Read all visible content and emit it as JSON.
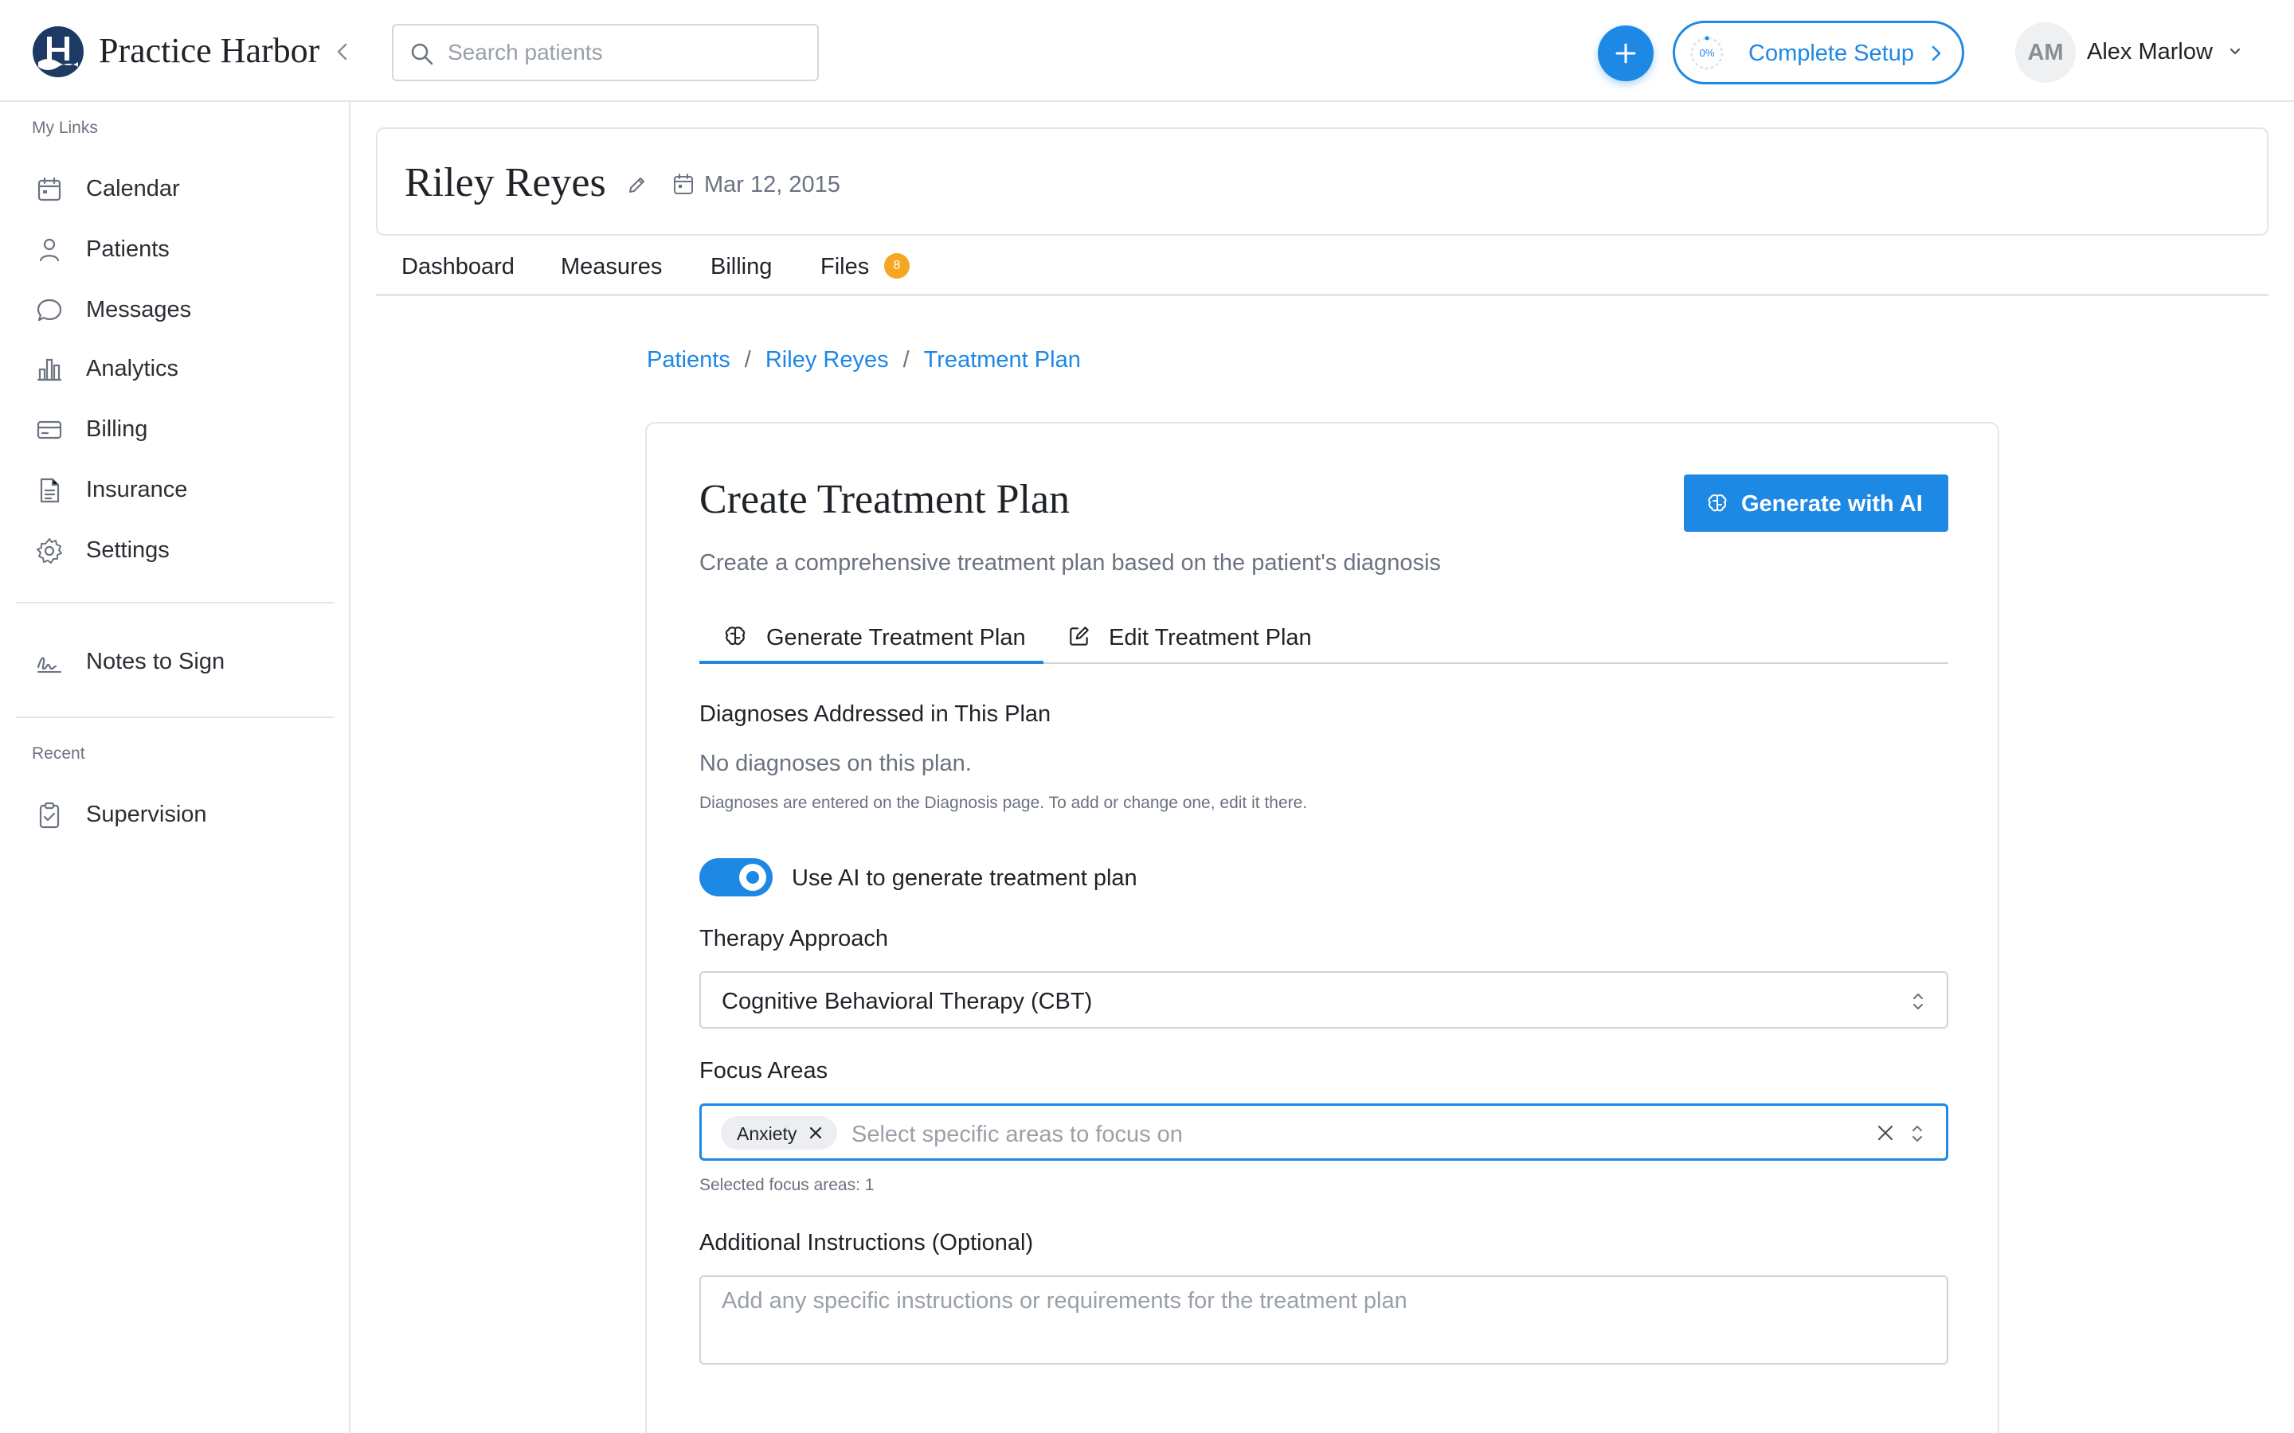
{
  "app": {
    "brand": "Practice Harbor"
  },
  "header": {
    "search_placeholder": "Search patients",
    "setup_progress": "0%",
    "setup_label": "Complete Setup",
    "user_initials": "AM",
    "user_name": "Alex Marlow",
    "accent_color": "#1e88e5"
  },
  "sidebar": {
    "my_links_label": "My Links",
    "items": [
      {
        "label": "Calendar",
        "icon": "calendar-icon"
      },
      {
        "label": "Patients",
        "icon": "person-icon"
      },
      {
        "label": "Messages",
        "icon": "chat-bubble-icon"
      },
      {
        "label": "Analytics",
        "icon": "bar-chart-icon"
      },
      {
        "label": "Billing",
        "icon": "credit-card-icon"
      },
      {
        "label": "Insurance",
        "icon": "document-icon"
      },
      {
        "label": "Settings",
        "icon": "gear-icon"
      }
    ],
    "notes_to_sign": "Notes to Sign",
    "recent_label": "Recent",
    "recent_items": [
      {
        "label": "Supervision",
        "icon": "clipboard-check-icon"
      }
    ]
  },
  "patient": {
    "name": "Riley Reyes",
    "dob": "Mar 12, 2015",
    "tabs": [
      {
        "label": "Dashboard"
      },
      {
        "label": "Measures"
      },
      {
        "label": "Billing"
      },
      {
        "label": "Files",
        "badge": "8"
      }
    ]
  },
  "breadcrumb": [
    {
      "label": "Patients"
    },
    {
      "label": "Riley Reyes"
    },
    {
      "label": "Treatment Plan"
    }
  ],
  "form": {
    "title": "Create Treatment Plan",
    "generate_button": "Generate with AI",
    "subtitle": "Create a comprehensive treatment plan based on the patient's diagnosis",
    "tabs": [
      {
        "label": "Generate Treatment Plan",
        "icon": "brain-icon",
        "active": true
      },
      {
        "label": "Edit Treatment Plan",
        "icon": "edit-square-icon",
        "active": false
      }
    ],
    "diagnoses_label": "Diagnoses Addressed in This Plan",
    "diagnoses_empty": "No diagnoses on this plan.",
    "diagnoses_hint": "Diagnoses are entered on the Diagnosis page. To add or change one, edit it there.",
    "use_ai_label": "Use AI to generate treatment plan",
    "use_ai_enabled": true,
    "therapy_label": "Therapy Approach",
    "therapy_value": "Cognitive Behavioral Therapy (CBT)",
    "focus_label": "Focus Areas",
    "focus_chips": [
      "Anxiety"
    ],
    "focus_placeholder": "Select specific areas to focus on",
    "focus_count_text": "Selected focus areas: 1",
    "instructions_label": "Additional Instructions (Optional)",
    "instructions_placeholder": "Add any specific instructions or requirements for the treatment plan"
  }
}
